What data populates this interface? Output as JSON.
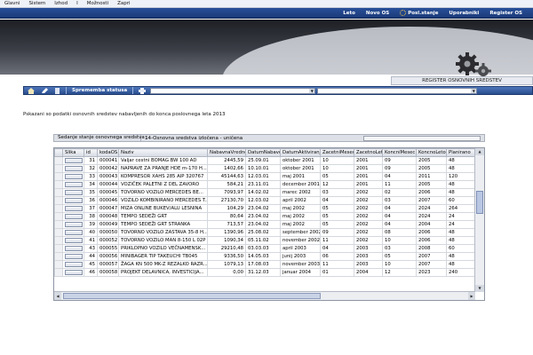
{
  "menubar": [
    "Glavni",
    "Sistem",
    "Izhod",
    "I",
    "Možnosti",
    "Zapri"
  ],
  "topnav": [
    "Leto",
    "Novo OS",
    "Posl.stanje",
    "Uporabniki",
    "Register OS"
  ],
  "register_title": "REGISTER OSNOVNIH SREDSTEV",
  "toolbar": {
    "label": "Sprememba statusa"
  },
  "info_text": "Pskazani so podatki osnovnih sredstev nabavljenih do konca poslovnega leta 2013",
  "state": {
    "label": "Sedanje stanje osnovnega sredstva :",
    "value": "14-Osnovna sredstva izločena - uničena"
  },
  "grid": {
    "columns": [
      "Slika",
      "id",
      "kodaOS",
      "Naziv",
      "NabavnaVrednost",
      "DatumNabave",
      "DatumAktiviranja",
      "ZacetniMesec",
      "ZacetnoLeto",
      "KoncniMesec",
      "KoncnoLeto",
      "Planirano"
    ],
    "rows": [
      [
        "",
        "31",
        "000041",
        "Valjar cestni BOMAG BW 100 AD",
        "2445,59",
        "25.09.01",
        "oktober 2001",
        "10",
        "2001",
        "09",
        "2005",
        "48"
      ],
      [
        "",
        "32",
        "000042",
        "NAPRAVE ZA PRANJE HDE m-170 H...",
        "1402,66",
        "10.10.01",
        "oktober 2001",
        "10",
        "2001",
        "09",
        "2005",
        "48"
      ],
      [
        "",
        "33",
        "000043",
        "KOMPRESOR XAHS 285 AIP 320767",
        "45144,63",
        "12.03.01",
        "maj 2001",
        "05",
        "2001",
        "04",
        "2011",
        "120"
      ],
      [
        "",
        "34",
        "000044",
        "VOZIČEK PALETNI Z DEL ZAVORO",
        "584,21",
        "23.11.01",
        "december 2001",
        "12",
        "2001",
        "11",
        "2005",
        "48"
      ],
      [
        "",
        "35",
        "000045",
        "TOVORNO VOZILO MERCEDES BE...",
        "7093,97",
        "14.02.02",
        "marec 2002",
        "03",
        "2002",
        "02",
        "2006",
        "48"
      ],
      [
        "",
        "36",
        "000046",
        "VOZILO KOMBINIRANO MERCEDES T...",
        "27130,70",
        "12.03.02",
        "april 2002",
        "04",
        "2002",
        "03",
        "2007",
        "60"
      ],
      [
        "",
        "37",
        "000047",
        "MIZA ONLINE BUKEV/ALU LESNINA",
        "104,29",
        "23.04.02",
        "maj 2002",
        "05",
        "2002",
        "04",
        "2024",
        "264"
      ],
      [
        "",
        "38",
        "000048",
        "TEMPO SEDEŽI GRT",
        "80,64",
        "23.04.02",
        "maj 2002",
        "05",
        "2002",
        "04",
        "2024",
        "24"
      ],
      [
        "",
        "39",
        "000049",
        "TEMPO SEDEŽI GRT STRANKA",
        "713,57",
        "23.04.02",
        "maj 2002",
        "05",
        "2002",
        "04",
        "2004",
        "24"
      ],
      [
        "",
        "40",
        "000050",
        "TOVORNO VOZILO ZASTAVA 35-8 H...",
        "1390,96",
        "25.08.02",
        "september 2002",
        "09",
        "2002",
        "08",
        "2006",
        "48"
      ],
      [
        "",
        "41",
        "000052",
        "TOVORNO VOZILO MAN 8-150 L 02P",
        "1090,34",
        "05.11.02",
        "november 2002",
        "11",
        "2002",
        "10",
        "2006",
        "48"
      ],
      [
        "",
        "43",
        "000055",
        "PRIKLOPNO VOZILO VEČNAMENSK...",
        "29210,48",
        "03.03.03",
        "april 2003",
        "04",
        "2003",
        "03",
        "2008",
        "60"
      ],
      [
        "",
        "44",
        "000056",
        "MINIBAGER TIP TAKEUCHI TB045",
        "9336,50",
        "14.05.03",
        "junij 2003",
        "06",
        "2003",
        "05",
        "2007",
        "48"
      ],
      [
        "",
        "45",
        "000057",
        "ŽAGA KN 500 MK-Z REZALKO RAZR...",
        "1079,13",
        "17.08.03",
        "november 2003",
        "11",
        "2003",
        "10",
        "2007",
        "48"
      ],
      [
        "",
        "46",
        "000058",
        "PROJEKT DELAVNICA, INVESTICIJA...",
        "0,00",
        "31.12.03",
        "januar 2004",
        "01",
        "2004",
        "12",
        "2023",
        "240"
      ]
    ]
  }
}
